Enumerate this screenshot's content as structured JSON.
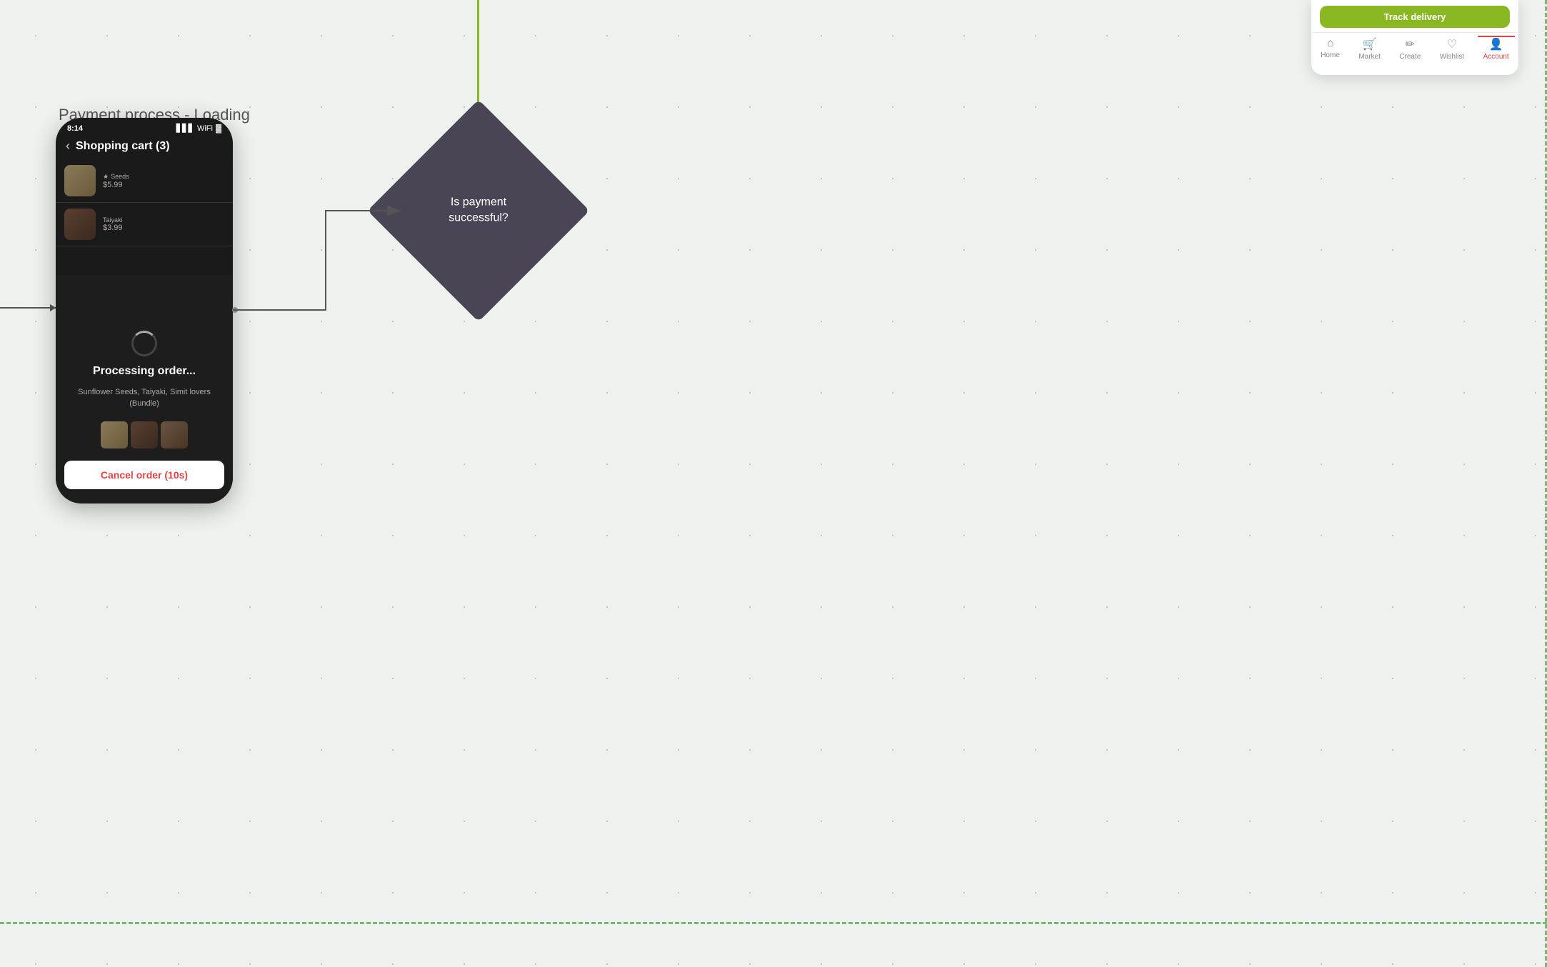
{
  "background": {
    "color": "#eef2ee"
  },
  "process_label": "Payment process - Loading",
  "phone": {
    "status_time": "8:14",
    "cart_title": "Shopping cart (3)",
    "items": [
      {
        "category": "Seeds",
        "price": "$5.99",
        "img_class": "item-img-seeds"
      },
      {
        "category": "Taiyaki",
        "price": "$3.99",
        "img_class": "item-img-taiyaki"
      }
    ],
    "processing_title": "Processing order...",
    "processing_subtitle": "Sunflower Seeds, Taiyaki, Simit lovers (Bundle)",
    "cancel_button": "Cancel order (10s)"
  },
  "decision_diamond": {
    "text_line1": "Is payment",
    "text_line2": "successful?"
  },
  "top_phone": {
    "track_button": "Track delivery",
    "nav_items": [
      {
        "label": "Home",
        "icon": "⊞",
        "active": false
      },
      {
        "label": "Market",
        "icon": "🛒",
        "active": false
      },
      {
        "label": "Create",
        "icon": "✏️",
        "active": false
      },
      {
        "label": "Wishlist",
        "icon": "♡",
        "active": false
      },
      {
        "label": "Account",
        "icon": "👤",
        "active": true
      }
    ]
  },
  "colors": {
    "accent_green": "#8ab820",
    "dark_phone": "#1a1a1a",
    "diamond_bg": "#4a4555",
    "cancel_red": "#d44444"
  }
}
